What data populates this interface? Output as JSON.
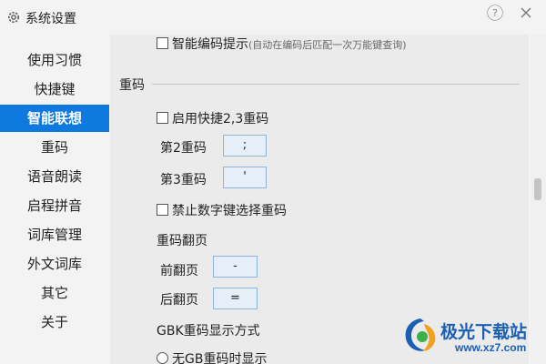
{
  "window": {
    "title": "系统设置",
    "icons": {
      "app": "gear-icon",
      "help": "question-circle-icon",
      "close": "close-icon"
    }
  },
  "sidebar": {
    "items": [
      {
        "label": "使用习惯",
        "active": false
      },
      {
        "label": "快捷键",
        "active": false
      },
      {
        "label": "智能联想",
        "active": true
      },
      {
        "label": "重码",
        "active": false
      },
      {
        "label": "语音朗读",
        "active": false
      },
      {
        "label": "启程拼音",
        "active": false
      },
      {
        "label": "词库管理",
        "active": false
      },
      {
        "label": "外文词库",
        "active": false
      },
      {
        "label": "其它",
        "active": false
      },
      {
        "label": "关于",
        "active": false
      }
    ]
  },
  "content": {
    "smart_code_hint": {
      "label": "智能编码提示",
      "hint": "(自动在编码后匹配一次万能键查询)",
      "checked": false
    },
    "section_title": "重码",
    "enable_shortcut": {
      "label": "启用快捷2,3重码",
      "checked": false
    },
    "second_code": {
      "label": "第2重码",
      "value": ";"
    },
    "third_code": {
      "label": "第3重码",
      "value": "'"
    },
    "disable_digit": {
      "label": "禁止数字键选择重码",
      "checked": false
    },
    "paging_title": "重码翻页",
    "prev_page": {
      "label": "前翻页",
      "value": "-"
    },
    "next_page": {
      "label": "后翻页",
      "value": "="
    },
    "gbk_title": "GBK重码显示方式",
    "gbk_option": {
      "label": "无GB重码时显示"
    }
  },
  "watermark": {
    "text": "极光下载站",
    "url": "www.xz7.com"
  },
  "colors": {
    "accent": "#0e7ae0",
    "keybox_bg": "#e6eef7",
    "keybox_border": "#8fb2d8"
  }
}
